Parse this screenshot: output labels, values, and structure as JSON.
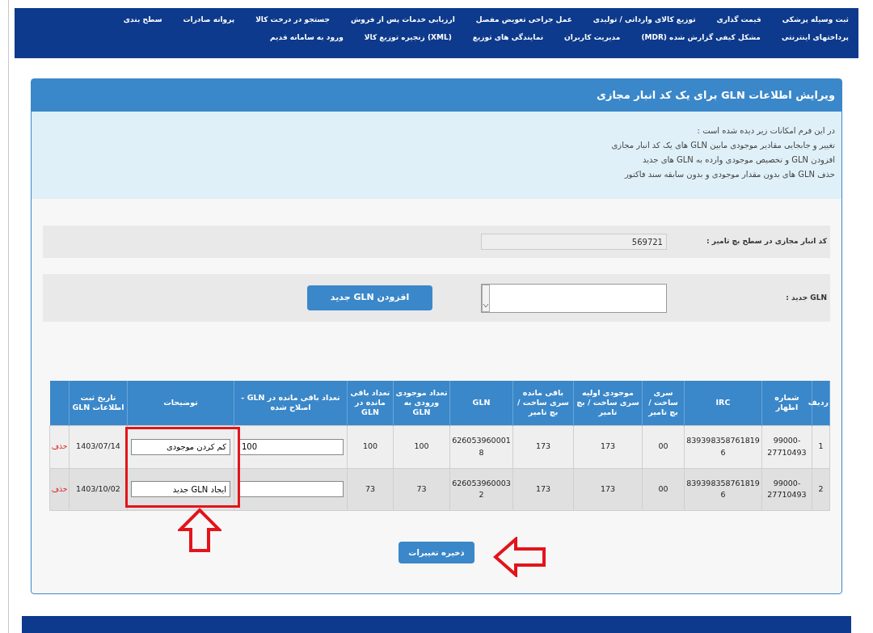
{
  "nav": {
    "rows": [
      [
        "ثبت وسیله پزشکی",
        "قیمت گذاری",
        "توزیع کالای وارداتی / تولیدی",
        "عمل جراحی تعویض مفصل",
        "ارزیابی خدمات پس از فروش",
        "جستجو در درخت کالا",
        "پروانه صادرات",
        "سطح بندی"
      ],
      [
        "پرداختهای اینترنتی",
        "مشکل کیفی گزارش شده (MDR)",
        "مدیریت کاربران",
        "نمایندگی های توزیع",
        "(XML) زنجیره توزیع کالا",
        "ورود به سامانه قدیم"
      ]
    ]
  },
  "panel": {
    "title": "ویرایش اطلاعات GLN برای یک کد انبار مجازی",
    "intro": [
      "در این فرم امکانات زیر دیده شده است :",
      "تغییر و جابجایی مقادیر موجودی مابین GLN های یک کد انبار مجازی",
      "افزودن GLN و تخصیص موجودی وارده به GLN های جدید",
      "حذف GLN های بدون مقدار موجودی و بدون سابقه سند فاکتور"
    ]
  },
  "form": {
    "warehouse": {
      "label": "کد انبار مجازی در سطح بچ تامیر :",
      "value": "569721"
    },
    "new_gln": {
      "label": "GLN جدید :",
      "button": "افزودن GLN جدید"
    }
  },
  "table": {
    "columns": [
      "ردیف",
      "شماره اظهار",
      "IRC",
      "سری ساخت / بچ تامیر",
      "موجودی اولیه سری ساخت / بچ تامیر",
      "باقی مانده سری ساخت / بچ تامیر",
      "GLN",
      "تعداد موجودی ورودی به GLN",
      "تعداد باقی مانده در GLN",
      "تعداد باقی مانده در GLN - اصلاح شده",
      "توضیحات",
      "تاریخ ثبت اطلاعات GLN"
    ],
    "rows": [
      {
        "cells": [
          "1",
          "99000-27710493",
          "8393983587618196",
          "00",
          "173",
          "173",
          "6260539600018",
          "100",
          "100"
        ],
        "corrected": "100",
        "description": "کم کردن موجودی",
        "date": "1403/07/14",
        "action": "حذف"
      },
      {
        "cells": [
          "2",
          "99000-27710493",
          "8393983587618196",
          "00",
          "173",
          "173",
          "6260539600032",
          "73",
          "73"
        ],
        "description": "ایجاد GLN جدید",
        "date": "1403/10/02",
        "action": "حذف"
      }
    ]
  },
  "save_button": "ذخیره تغییرات"
}
